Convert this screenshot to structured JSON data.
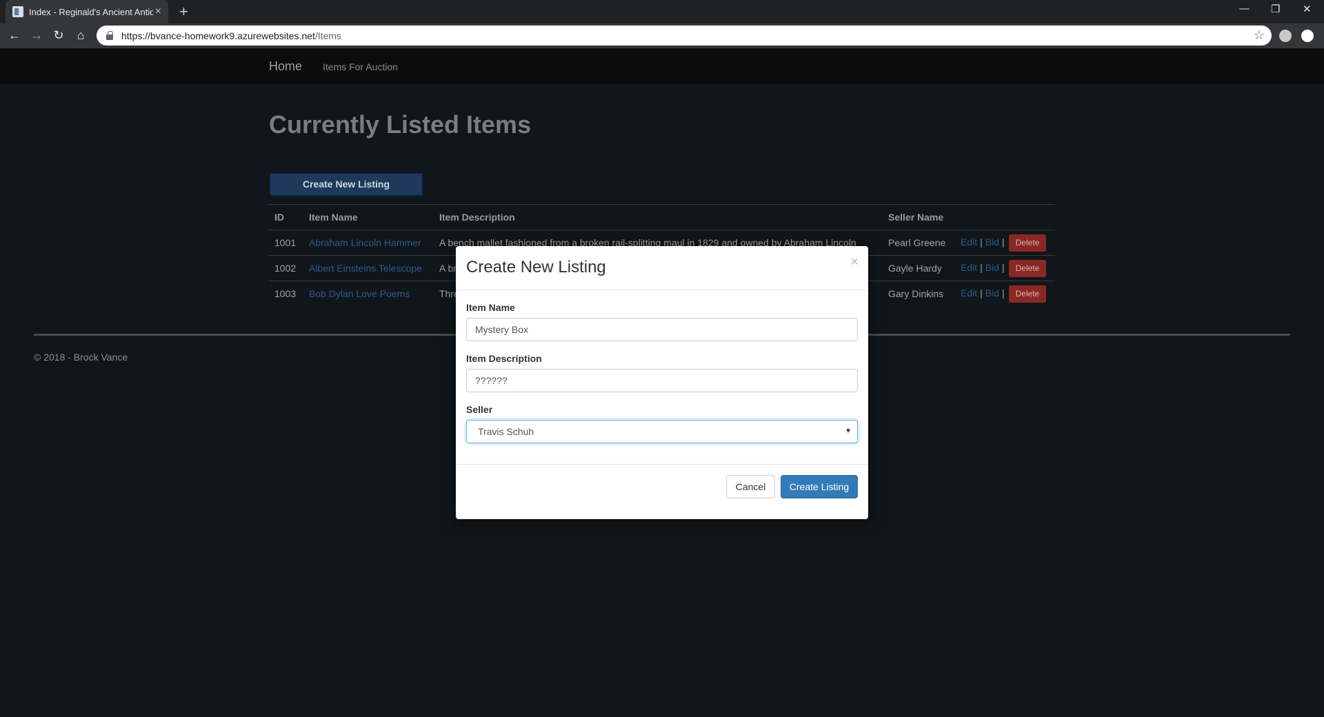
{
  "browser": {
    "tab_title": "Index - Reginald's Ancient Antiqu",
    "tab_close": "×",
    "new_tab": "+",
    "url_host": "https://bvance-homework9.azurewebsites.net",
    "url_path": "/Items",
    "minimize": "—",
    "restore": "❐",
    "close": "✕"
  },
  "navbar": {
    "brand": "Home",
    "links": [
      "Items For Auction"
    ]
  },
  "page": {
    "title": "Currently Listed Items",
    "create_button": "Create New Listing"
  },
  "table": {
    "headers": [
      "ID",
      "Item Name",
      "Item Description",
      "Seller Name",
      ""
    ],
    "rows": [
      {
        "id": "1001",
        "name": "Abraham Lincoln Hammer",
        "description": "A bench mallet fashioned from a broken rail-splitting maul in 1829 and owned by Abraham Lincoln",
        "seller": "Pearl Greene"
      },
      {
        "id": "1002",
        "name": "Albert Einsteins Telescope",
        "description": "A br",
        "seller": "Gayle Hardy"
      },
      {
        "id": "1003",
        "name": "Bob Dylan Love Poems",
        "description": "Thre",
        "seller": "Gary Dinkins"
      }
    ],
    "actions": {
      "edit": "Edit",
      "bid": "Bid",
      "delete": "Delete",
      "separator": "|"
    }
  },
  "footer": {
    "text": "© 2018 - Brock Vance"
  },
  "modal": {
    "title": "Create New Listing",
    "close": "×",
    "fields": {
      "item_name_label": "Item Name",
      "item_name_value": "Mystery Box",
      "item_description_label": "Item Description",
      "item_description_value": "??????",
      "seller_label": "Seller",
      "seller_value": "Travis Schuh"
    },
    "cancel": "Cancel",
    "submit": "Create Listing"
  },
  "colors": {
    "page_bg": "#11161a",
    "navbar_bg": "#0c0c0c",
    "link": "#2b5a8c",
    "delete": "#8a2824",
    "primary": "#337ab7"
  }
}
